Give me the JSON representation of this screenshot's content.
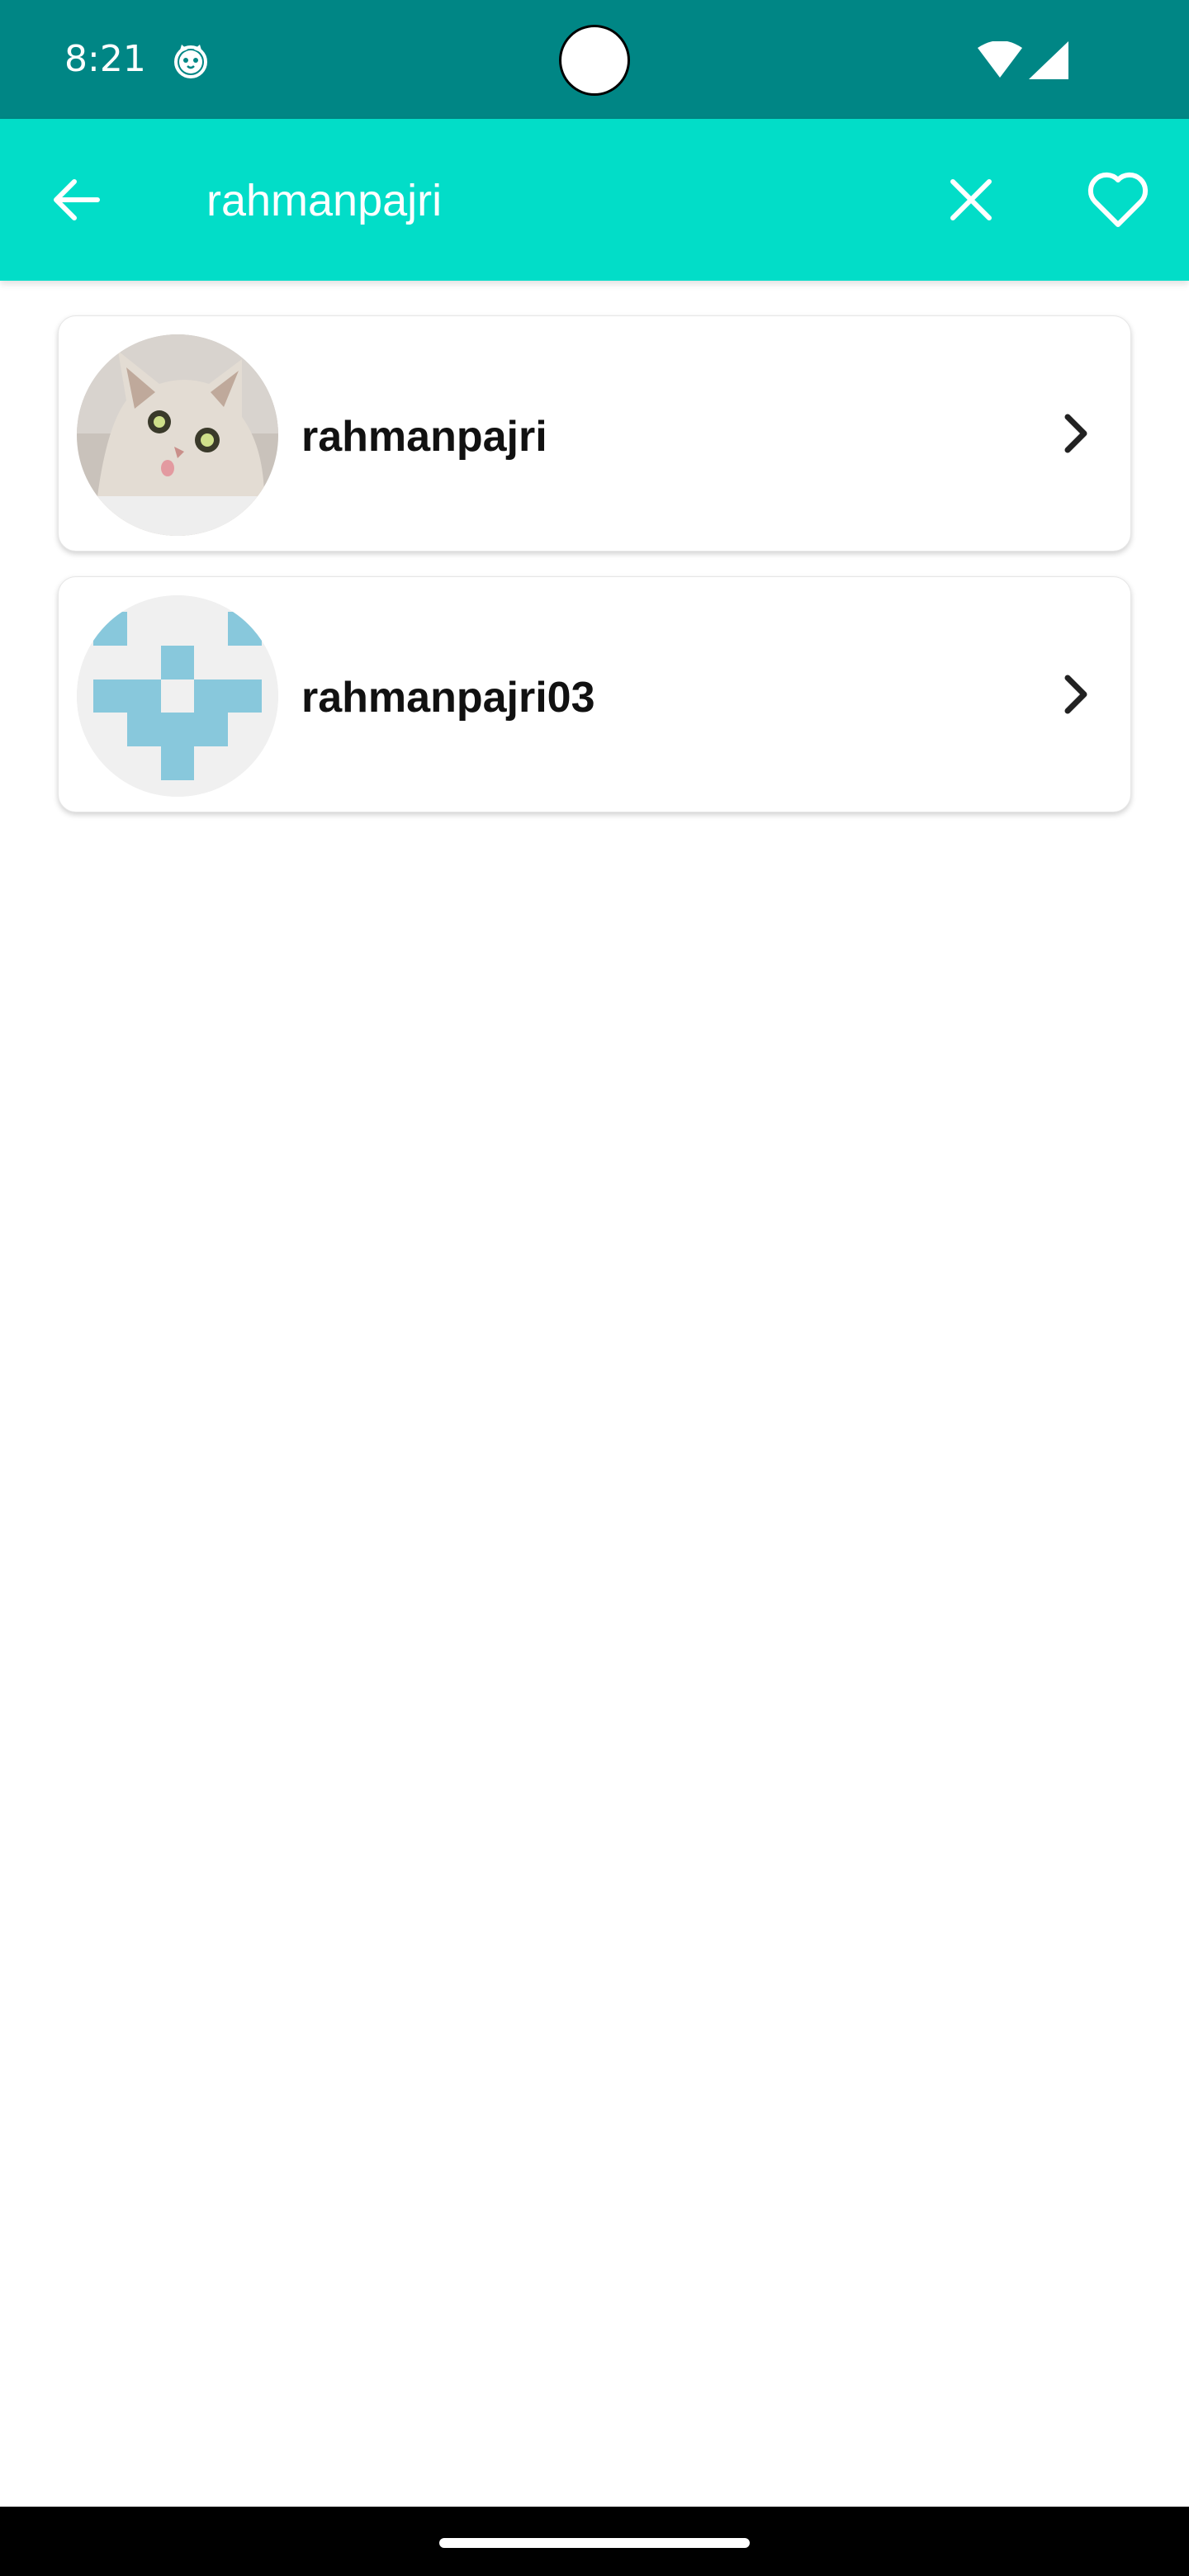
{
  "status_bar": {
    "time": "8:21",
    "app_icon": "cat-face-icon",
    "wifi_icon": "wifi-icon",
    "signal_icon": "cell-signal-icon",
    "background_color": "#008685"
  },
  "app_bar": {
    "background_color": "#02DDC8",
    "back_icon": "arrow-left-icon",
    "search_value": "rahmanpajri",
    "clear_icon": "close-icon",
    "favorite_icon": "heart-outline-icon"
  },
  "users": [
    {
      "login": "rahmanpajri",
      "avatar": "cat-photo-avatar",
      "chevron": "chevron-right-icon"
    },
    {
      "login": "rahmanpajri03",
      "avatar": "identicon-avatar",
      "chevron": "chevron-right-icon"
    }
  ]
}
